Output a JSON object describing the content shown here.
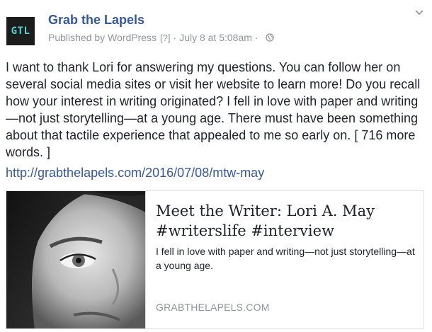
{
  "post": {
    "avatar_text": "GTL",
    "page_name": "Grab the Lapels",
    "meta": {
      "published_by": "Published by WordPress",
      "help_mark": "[?]",
      "separator": "·",
      "date": "July 8 at 5:08am",
      "privacy_icon": "globe-icon"
    },
    "options_icon": "chevron-down-icon",
    "message": "I want to thank Lori for answering my questions. You can follow her on several social media sites or visit her website to learn more! Do you recall how your interest in writing originated? I fell in love with paper and writing—not just storytelling—at a young age. There must have been something about that tactile experience that appealed to me so early on. [ 716 more words. ]",
    "link": "http://grabthelapels.com/2016/07/08/mtw-may",
    "card": {
      "title": "Meet the Writer: Lori A. May #writerslife #interview",
      "description": "I fell in love with paper and writing—not just storytelling—at a young age.",
      "domain": "GRABTHELAPELS.COM"
    }
  },
  "colors": {
    "link_blue": "#365899",
    "meta_gray": "#90949c",
    "text": "#1d2129",
    "avatar_bg": "#1c1c1c",
    "avatar_text": "#57d2cf",
    "border": "#dddfe2"
  }
}
